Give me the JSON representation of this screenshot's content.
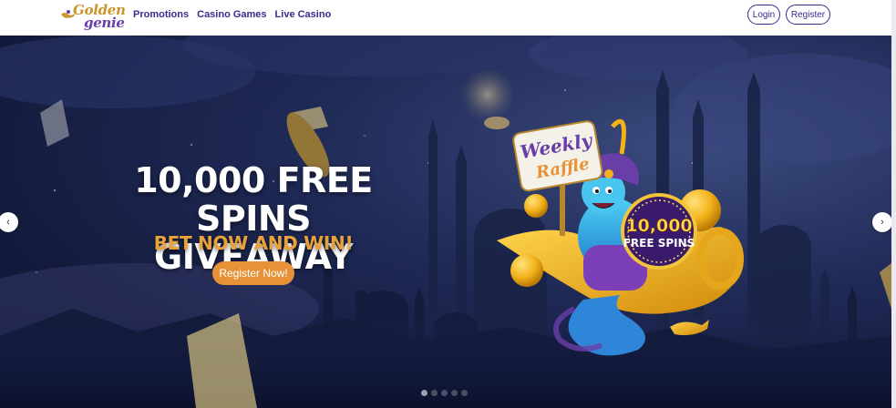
{
  "header": {
    "logo": {
      "top": "Golden",
      "bottom": "genie"
    },
    "nav": [
      {
        "label": "Promotions"
      },
      {
        "label": "Casino Games"
      },
      {
        "label": "Live Casino"
      }
    ],
    "login_label": "Login",
    "register_label": "Register"
  },
  "hero": {
    "headline_line1": "10,000 FREE SPINS",
    "headline_line2": "GIVEAWAY",
    "subheadline": "BET NOW AND WIN!",
    "cta_label": "Register Now!",
    "sign_line1": "Weekly",
    "sign_line2": "Raffle",
    "badge_number": "10,000",
    "badge_text": "FREE SPINS",
    "prev_icon": "chevron-left-icon",
    "next_icon": "chevron-right-icon",
    "slide_count": 5,
    "active_slide": 1
  },
  "colors": {
    "brand_purple": "#3d2a8c",
    "accent_orange": "#e79236",
    "gold": "#c9972b"
  }
}
